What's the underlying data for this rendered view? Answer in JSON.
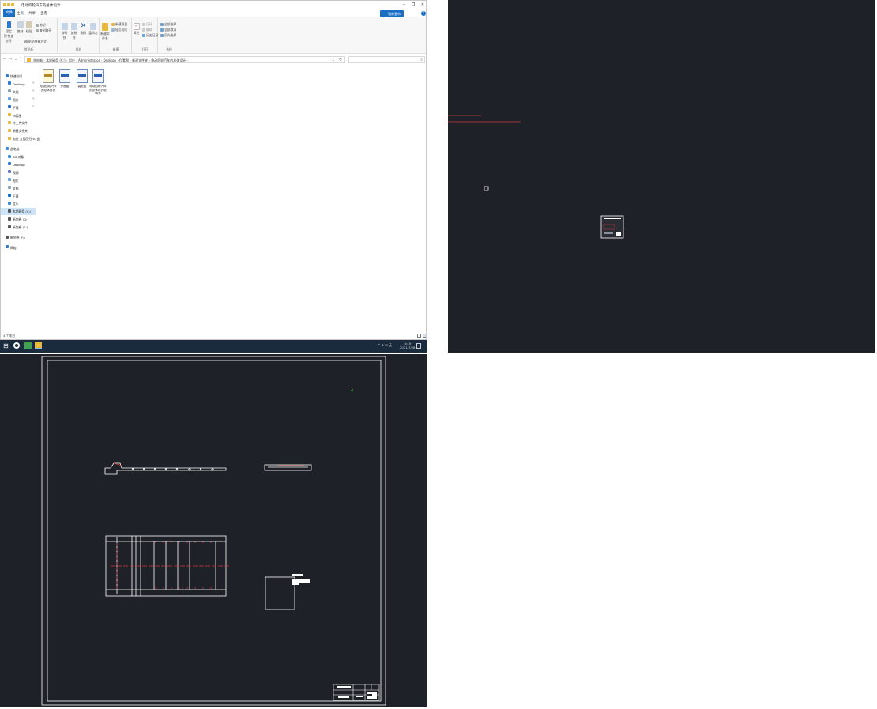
{
  "explorer": {
    "window_title": "电动四轮汽车的总体设计",
    "tabs": [
      "文件",
      "主页",
      "共享",
      "查看"
    ],
    "share_button": "强林云市",
    "help_icon": "?",
    "ribbon": {
      "groups": [
        {
          "label": "剪贴板",
          "big": [
            "固定到'快速访问'",
            "复制",
            "粘贴"
          ],
          "small": [
            "剪切",
            "复制路径",
            "粘贴快捷方式"
          ]
        },
        {
          "label": "组织",
          "big": [
            "移动到",
            "复制到",
            "删除",
            "重命名"
          ]
        },
        {
          "label": "新建",
          "big": [
            "新建文件夹"
          ],
          "small": [
            "新建项目",
            "轻松访问"
          ]
        },
        {
          "label": "打开",
          "big": [
            "属性"
          ],
          "small": [
            "打开",
            "编辑",
            "历史记录"
          ]
        },
        {
          "label": "选择",
          "small": [
            "全部选择",
            "全部取消",
            "反向选择"
          ]
        }
      ]
    },
    "address": {
      "crumbs": [
        "此电脑",
        "本地磁盘 (C:)",
        "用户",
        "Administrator",
        "Desktop",
        "fa素图",
        "新建文件夹",
        "电动四轮汽车的总体设计"
      ]
    },
    "nav": {
      "quick_access": "快速访问",
      "items": [
        {
          "label": "Desktop",
          "pinned": true,
          "color": "#2b7bd6"
        },
        {
          "label": "文档",
          "pinned": true,
          "color": "#8aa0b8"
        },
        {
          "label": "图片",
          "pinned": true,
          "color": "#6aa3d8"
        },
        {
          "label": "下载",
          "pinned": true,
          "color": "#1a6fc4"
        },
        {
          "label": "fa素图",
          "pinned": false,
          "color": "#e8b83b"
        },
        {
          "label": "待上传文件",
          "pinned": false,
          "color": "#e8b83b"
        },
        {
          "label": "新建文件夹",
          "pinned": false,
          "color": "#e8b83b"
        },
        {
          "label": "电控 五层回归FAT变",
          "pinned": false,
          "color": "#e8b83b"
        }
      ],
      "this_pc": "此电脑",
      "pc_items": [
        {
          "label": "3D 对象",
          "color": "#3a8fd8"
        },
        {
          "label": "Desktop",
          "color": "#2b7bd6"
        },
        {
          "label": "视频",
          "color": "#6a7bb8"
        },
        {
          "label": "图片",
          "color": "#6aa3d8"
        },
        {
          "label": "文档",
          "color": "#8aa0b8"
        },
        {
          "label": "下载",
          "color": "#1a6fc4"
        },
        {
          "label": "音乐",
          "color": "#3a8fd8"
        },
        {
          "label": "本地磁盘 (C:)",
          "color": "#555555",
          "selected": true
        },
        {
          "label": "新加卷 (D:)",
          "color": "#555555"
        },
        {
          "label": "新加卷 (E:)",
          "color": "#555555"
        }
      ],
      "network_drive": "新加卷 (F:)",
      "network": "网络"
    },
    "files": [
      {
        "name": "电动四轮汽车的总体设计",
        "type": "rar"
      },
      {
        "name": "外面图",
        "type": "dwg"
      },
      {
        "name": "装配图",
        "type": "dwg"
      },
      {
        "name": "电动四轮汽车的总体设计说明书",
        "type": "doc"
      }
    ],
    "status": "4 个项目"
  },
  "taskbar": {
    "tray": "^ ⊕ ⊡ 英",
    "time": "8:49",
    "date": "2021/7/28"
  },
  "colors": {
    "cad_bg": "#1e2127",
    "cad_line": "#ffffff",
    "cad_red": "#d23a3a",
    "accent": "#1a6fc4"
  }
}
